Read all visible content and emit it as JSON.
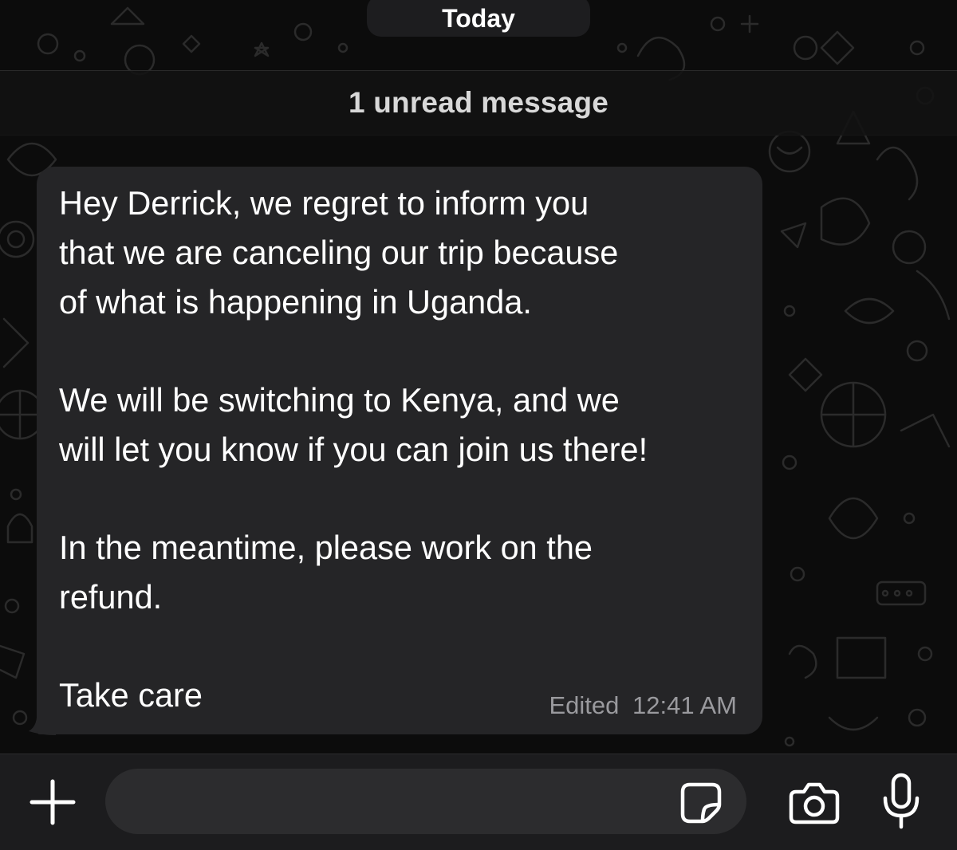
{
  "chat": {
    "date_label": "Today",
    "unread_label": "1 unread message"
  },
  "message": {
    "lines": [
      "Hey Derrick, we regret to inform you",
      "that we are canceling our trip because",
      "of what is happening in Uganda.",
      "",
      "We will be switching to Kenya, and we",
      "will let you know if you can join us there!",
      "",
      "In the meantime, please work on the",
      "refund.",
      "",
      "Take care"
    ],
    "edited_label": "Edited",
    "time": "12:41 AM"
  },
  "composer": {
    "attach_icon": "plus-icon",
    "sticker_icon": "sticker-icon",
    "camera_icon": "camera-icon",
    "mic_icon": "microphone-icon",
    "input_placeholder": ""
  },
  "colors": {
    "background": "#0c0c0c",
    "bubble": "#252527",
    "composer": "#1c1c1e",
    "text": "#ffffff",
    "meta": "#9a9a9e"
  }
}
